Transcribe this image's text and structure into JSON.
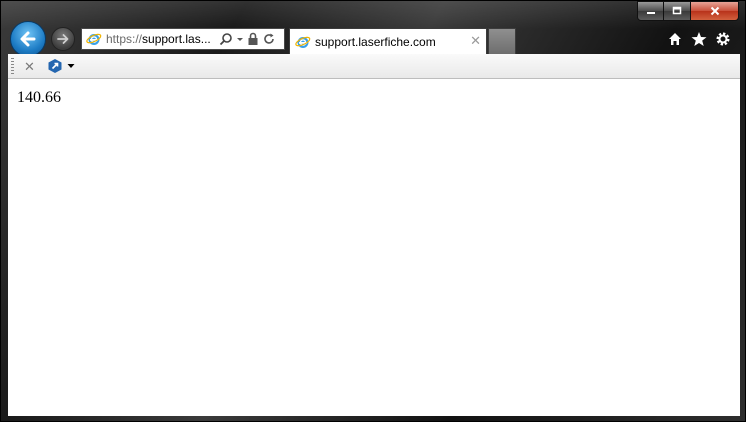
{
  "window": {
    "controls": {
      "minimize": "minimize",
      "maximize": "maximize",
      "close": "close"
    }
  },
  "nav": {
    "back_icon": "back-arrow-icon",
    "forward_icon": "forward-arrow-icon"
  },
  "address_bar": {
    "url_protocol": "https://",
    "url_rest": "support.las...",
    "icons": [
      "search-icon",
      "dropdown-icon",
      "lock-icon",
      "refresh-icon"
    ]
  },
  "tabs": [
    {
      "label": "support.laserfiche.com",
      "active": true,
      "icon": "ie-icon"
    }
  ],
  "toolbar_right": {
    "icons": [
      "home-icon",
      "favorites-star-icon",
      "settings-gear-icon"
    ]
  },
  "command_bar": {
    "close_icon": "close-icon",
    "addon_icon": "addon-icon"
  },
  "page": {
    "text": "140.66"
  },
  "colors": {
    "accent": "#1d7cc5",
    "close_red": "#c9503a",
    "page_bg": "#ffffff"
  }
}
